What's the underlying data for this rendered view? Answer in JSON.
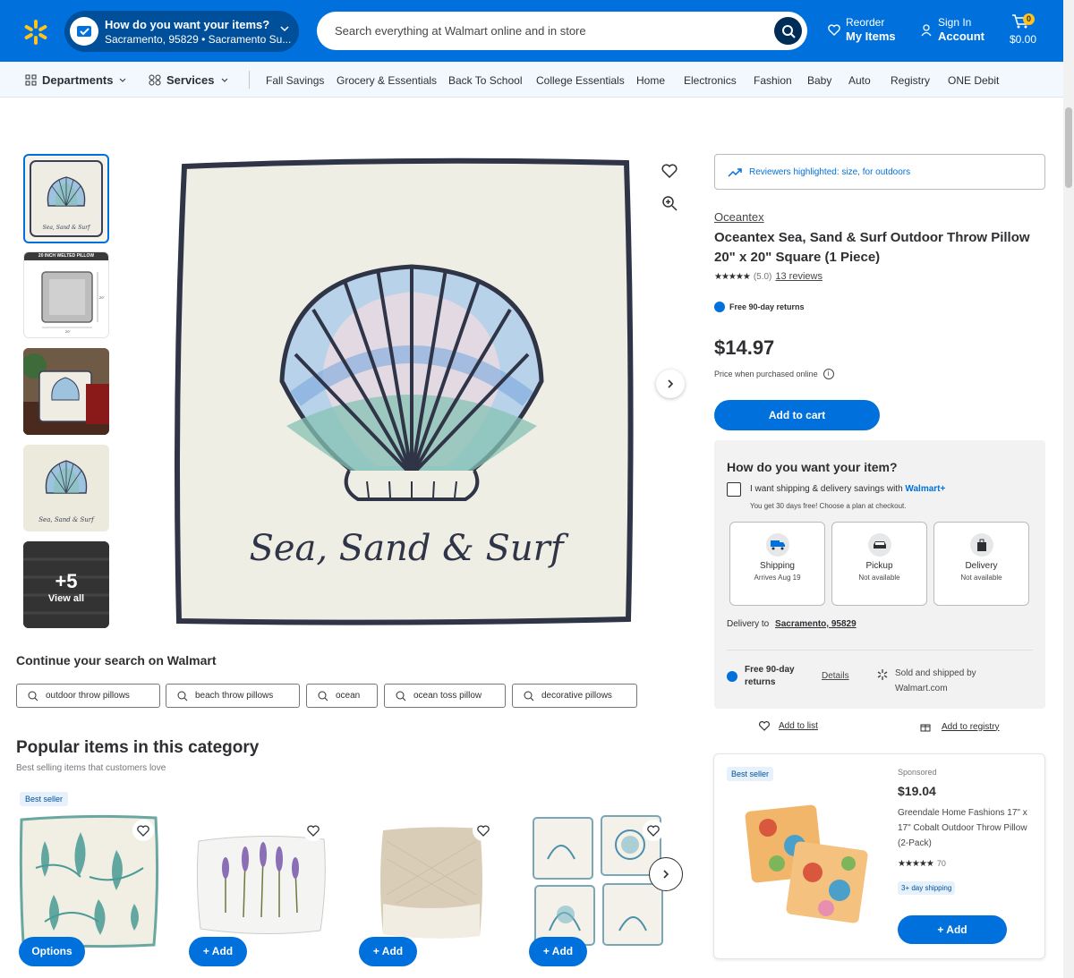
{
  "header": {
    "location_prompt": "How do you want your items?",
    "location_value": "Sacramento, 95829 • Sacramento Su...",
    "search_placeholder": "Search everything at Walmart online and in store",
    "reorder_top": "Reorder",
    "reorder_bottom": "My Items",
    "signin_top": "Sign In",
    "signin_bottom": "Account",
    "cart_count": "0",
    "cart_total": "$0.00",
    "brand_color": "#0071dc",
    "spark_color": "#ffc220"
  },
  "subnav": {
    "departments": "Departments",
    "services": "Services",
    "links": [
      "Fall Savings",
      "Grocery & Essentials",
      "Back To School",
      "College Essentials",
      "Home",
      "Electronics",
      "Fashion",
      "Baby",
      "Auto",
      "Registry",
      "ONE Debit"
    ]
  },
  "gallery": {
    "thumb2_label": "20 INCH WELTED PILLOW",
    "thumb2_dim_v": "20\"",
    "thumb2_dim_h": "20\"",
    "more_count": "+5",
    "view_all": "View all",
    "pillow_text": "Sea, Sand & Surf"
  },
  "product": {
    "reviewers_highlighted": "Reviewers highlighted: size, for outdoors",
    "brand": "Oceantex",
    "title": "Oceantex Sea, Sand & Surf Outdoor Throw Pillow 20\" x 20\" Square (1 Piece)",
    "stars": "★★★★★",
    "rating": "(5.0)",
    "reviews": "13 reviews",
    "returns": "Free 90-day returns",
    "price": "$14.97",
    "price_note": "Price when purchased online",
    "add_to_cart": "Add to cart"
  },
  "fulfillment": {
    "title": "How do you want your item?",
    "plus_label": "I want shipping & delivery savings with",
    "plus_brand": "Walmart+",
    "plus_sub": "You get 30 days free! Choose a plan at checkout.",
    "options": [
      {
        "name": "Shipping",
        "sub": "Arrives Aug 19",
        "icon": "truck-icon"
      },
      {
        "name": "Pickup",
        "sub": "Not available",
        "icon": "car-icon"
      },
      {
        "name": "Delivery",
        "sub": "Not available",
        "icon": "bag-icon"
      }
    ],
    "delivery_to": "Delivery to",
    "delivery_loc": "Sacramento, 95829",
    "free_returns_1": "Free 90-day",
    "free_returns_2": "returns",
    "details": "Details",
    "sold_by_1": "Sold and shipped by",
    "sold_by_2": "Walmart.com",
    "add_to_list": "Add to list",
    "add_to_registry": "Add to registry"
  },
  "sponsored": {
    "badge": "Best seller",
    "label": "Sponsored",
    "price": "$19.04",
    "name": "Greendale Home Fashions 17\" x 17\" Cobalt Outdoor Throw Pillow (2-Pack)",
    "stars": "★★★★★",
    "count": "70",
    "shipping": "3+ day shipping",
    "add": "+ Add"
  },
  "continue_search": {
    "title": "Continue your search on Walmart",
    "chips": [
      "outdoor throw pillows",
      "beach throw pillows",
      "ocean",
      "ocean toss pillow",
      "decorative pillows"
    ]
  },
  "popular": {
    "title": "Popular items in this category",
    "subtitle": "Best selling items that customers love",
    "badge": "Best seller",
    "buttons": [
      "Options",
      "+ Add",
      "+ Add",
      "+ Add"
    ]
  }
}
